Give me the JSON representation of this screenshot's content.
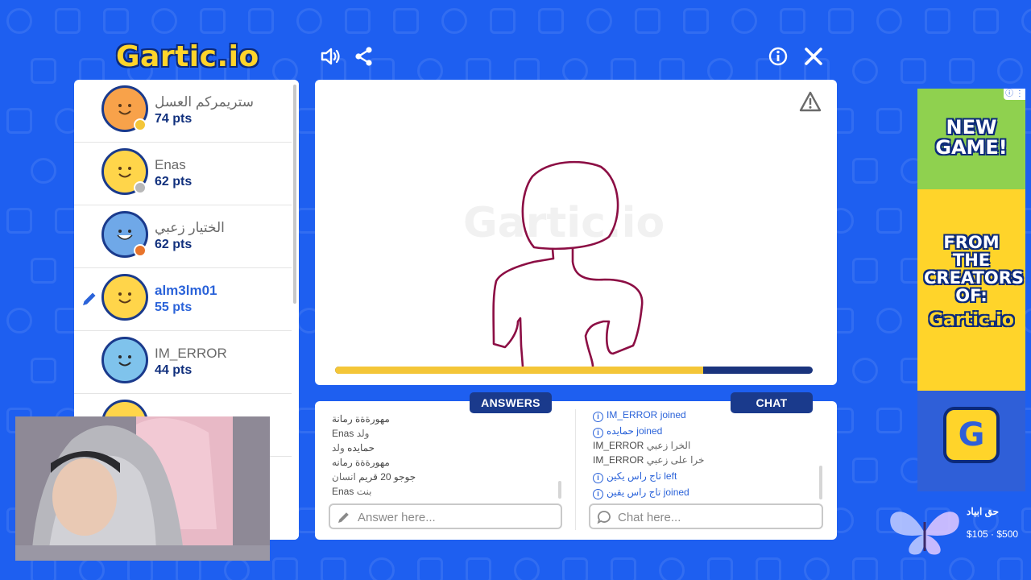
{
  "app": {
    "logo_text": "Gartic.io"
  },
  "header": {
    "sound_icon": "speaker-icon",
    "share_icon": "share-icon",
    "info_icon": "info-icon",
    "close_icon": "close-icon"
  },
  "players": [
    {
      "name": "ستريمركم العسل",
      "points": "74 pts",
      "status_color": "#f4c638",
      "active": false
    },
    {
      "name": "Enas",
      "points": "62 pts",
      "status_color": "#b8b8b8",
      "active": false
    },
    {
      "name": "الختيار زعبي",
      "points": "62 pts",
      "status_color": "#e8742c",
      "active": false
    },
    {
      "name": "alm3lm01",
      "points": "55 pts",
      "status_color": "",
      "active": true
    },
    {
      "name": "IM_ERROR",
      "points": "44 pts",
      "status_color": "",
      "active": false
    }
  ],
  "canvas": {
    "watermark": "Gartic.io",
    "report_icon": "warning-icon",
    "timer_remaining": 0.77,
    "timer_color": "#f4c638"
  },
  "answers": {
    "tab_label": "ANSWERS",
    "messages": [
      {
        "user": "مهورةةة رمانة",
        "text": ""
      },
      {
        "user": "Enas",
        "text": "ولد"
      },
      {
        "user": "حمايده",
        "text": "ولد"
      },
      {
        "user": "مهورةةة رمانه",
        "text": ""
      },
      {
        "user": "جوجو 20 قريم",
        "text": "انسان"
      },
      {
        "user": "Enas",
        "text": "بنت"
      }
    ],
    "input_placeholder": "Answer here..."
  },
  "chat": {
    "tab_label": "CHAT",
    "messages": [
      {
        "type": "system",
        "user": "IM_ERROR",
        "action": "joined"
      },
      {
        "type": "system",
        "user": "حمايده",
        "action": "joined"
      },
      {
        "type": "user",
        "user": "IM_ERROR",
        "text": "الخرا زعبي"
      },
      {
        "type": "user",
        "user": "IM_ERROR",
        "text": "خرا على زعبي"
      },
      {
        "type": "system",
        "user": "تاج راس يكين",
        "action": "left"
      },
      {
        "type": "system",
        "user": "تاج راس يقين",
        "action": "joined"
      }
    ],
    "input_placeholder": "Chat here..."
  },
  "ad": {
    "headline": "NEW GAME!",
    "subline": "FROM THE CREATORS OF:",
    "brand": "Gartic.io",
    "app_icon_letter": "G",
    "badge": "ⓘ ⋮"
  },
  "donation": {
    "name": "حق ابياد",
    "amount": "$105 · $500"
  }
}
